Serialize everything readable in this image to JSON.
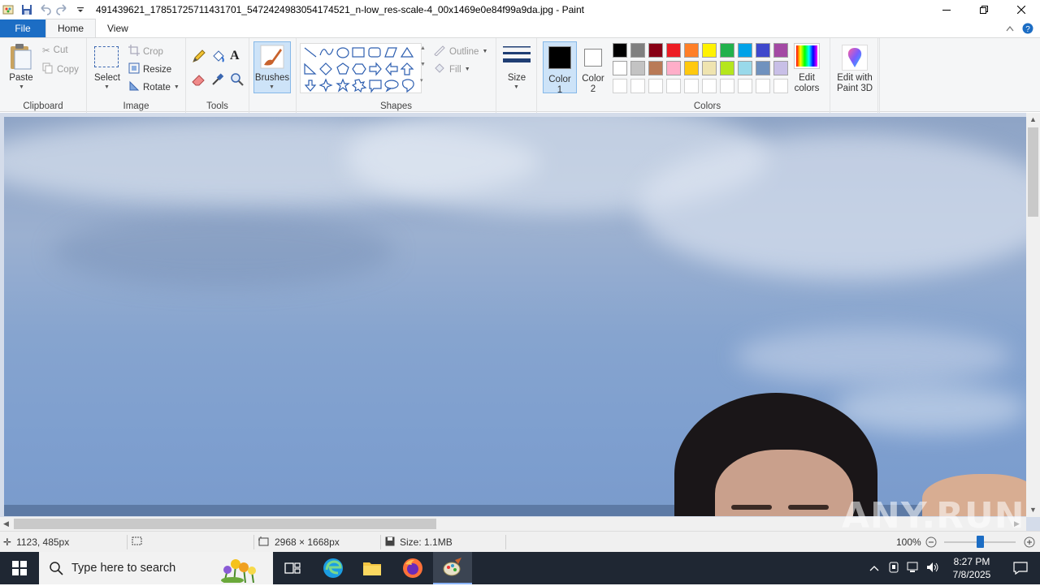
{
  "window": {
    "title": "491439621_17851725711431701_5472424983054174521_n-low_res-scale-4_00x1469e0e84f99a9da.jpg - Paint"
  },
  "tabs": [
    {
      "label": "File"
    },
    {
      "label": "Home"
    },
    {
      "label": "View"
    }
  ],
  "ribbon": {
    "clipboard": {
      "paste": "Paste",
      "cut": "Cut",
      "copy": "Copy",
      "group": "Clipboard"
    },
    "image": {
      "select": "Select",
      "crop": "Crop",
      "resize": "Resize",
      "rotate": "Rotate",
      "group": "Image"
    },
    "tools": {
      "group": "Tools"
    },
    "brushes": {
      "label": "Brushes"
    },
    "shapes": {
      "outline": "Outline",
      "fill": "Fill",
      "group": "Shapes"
    },
    "size": {
      "label": "Size"
    },
    "colors": {
      "color1": "Color\n1",
      "color1_a": "Color",
      "color1_b": "1",
      "color2_a": "Color",
      "color2_b": "2",
      "edit_a": "Edit",
      "edit_b": "colors",
      "group": "Colors",
      "palette_row1": [
        "#000000",
        "#7f7f7f",
        "#880015",
        "#ed1c24",
        "#ff7f27",
        "#fff200",
        "#22b14c",
        "#00a2e8",
        "#3f48cc",
        "#a349a4"
      ],
      "palette_row2": [
        "#ffffff",
        "#c3c3c3",
        "#b97a57",
        "#ffaec9",
        "#ffc90e",
        "#efe4b0",
        "#b5e61d",
        "#99d9ea",
        "#7092be",
        "#c8bfe7"
      ]
    },
    "paint3d": {
      "line1": "Edit with",
      "line2": "Paint 3D"
    }
  },
  "status": {
    "cursor": "1123, 485px",
    "dimensions": "2968 × 1668px",
    "size": "Size: 1.1MB",
    "zoom": "100%"
  },
  "watermark": "ANY.RUN",
  "taskbar": {
    "search_placeholder": "Type here to search",
    "time": "8:27 PM",
    "date": "7/8/2025"
  }
}
